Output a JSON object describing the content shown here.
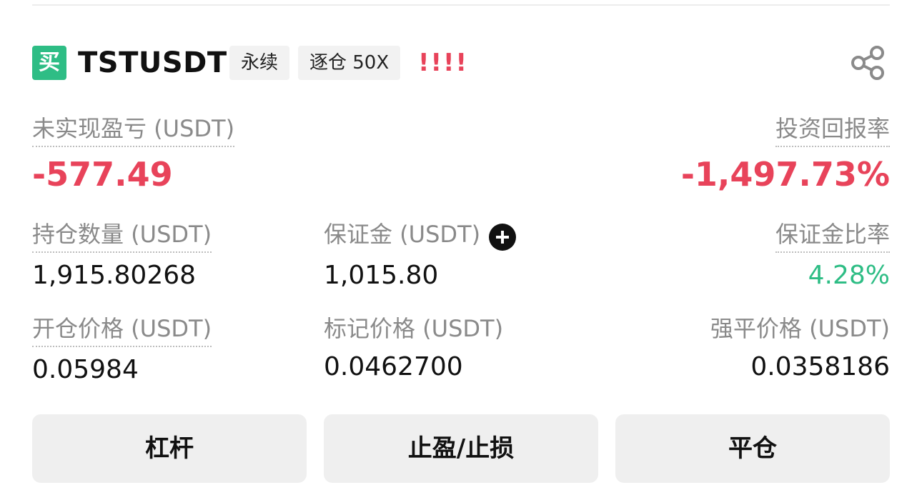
{
  "position": {
    "side_badge": "买",
    "symbol": "TSTUSDT",
    "tags": [
      "永续",
      "逐仓 50X"
    ],
    "risk_indicator": "!!!!"
  },
  "pnl": {
    "unrealized_label": "未实现盈亏 (USDT)",
    "unrealized_value": "-577.49",
    "roi_label": "投资回报率",
    "roi_value": "-1,497.73%"
  },
  "metrics": {
    "size_label": "持仓数量 (USDT)",
    "size_value": "1,915.80268",
    "margin_label": "保证金 (USDT)",
    "margin_value": "1,015.80",
    "margin_ratio_label": "保证金比率",
    "margin_ratio_value": "4.28%",
    "entry_label": "开仓价格 (USDT)",
    "entry_value": "0.05984",
    "mark_label": "标记价格 (USDT)",
    "mark_value": "0.0462700",
    "liq_label": "强平价格 (USDT)",
    "liq_value": "0.0358186"
  },
  "actions": {
    "leverage": "杠杆",
    "tpsl": "止盈/止损",
    "close": "平仓"
  },
  "icons": {
    "share": "share-icon",
    "add_margin": "plus-circle-icon"
  },
  "colors": {
    "buy_green": "#2ebd85",
    "loss_red": "#e8435a",
    "label_gray": "#8a8a8a"
  }
}
